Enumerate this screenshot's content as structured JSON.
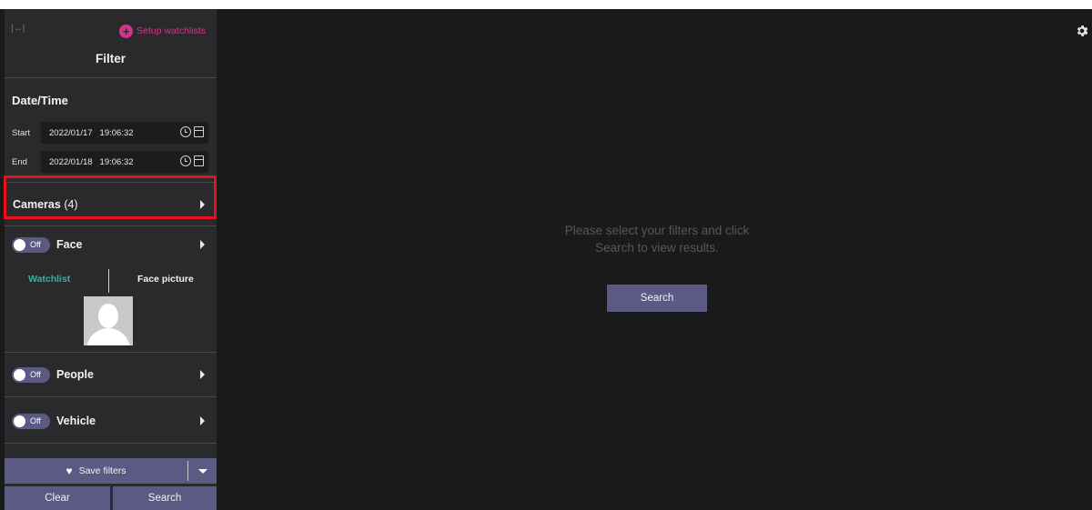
{
  "sidebar": {
    "setup_watchlists": "Setup watchlists",
    "filter_title": "Filter",
    "datetime": {
      "title": "Date/Time",
      "start_label": "Start",
      "start_date": "2022/01/17",
      "start_time": "19:06:32",
      "end_label": "End",
      "end_date": "2022/01/18",
      "end_time": "19:06:32"
    },
    "cameras": {
      "label": "Cameras",
      "count": "(4)"
    },
    "face": {
      "toggle": "Off",
      "label": "Face",
      "tab_watchlist": "Watchlist",
      "tab_face_picture": "Face picture"
    },
    "people": {
      "toggle": "Off",
      "label": "People"
    },
    "vehicle": {
      "toggle": "Off",
      "label": "Vehicle"
    },
    "save_filters": "Save filters",
    "clear": "Clear",
    "search": "Search"
  },
  "main": {
    "message_line1": "Please select your filters and click",
    "message_line2": "Search to view results.",
    "search": "Search"
  },
  "colors": {
    "accent_pink": "#d6338d",
    "button_purple": "#5a5a84",
    "watchlist_teal": "#2fb4a6",
    "highlight_red": "#e8111a"
  },
  "icons": {
    "collapse": "expand-horizontal-icon",
    "setup": "plus-circle-icon",
    "clock": "clock-icon",
    "calendar": "calendar-icon",
    "caret": "chevron-right-icon",
    "heart": "heart-icon",
    "dropdown": "caret-down-icon",
    "settings": "gear-icon"
  }
}
